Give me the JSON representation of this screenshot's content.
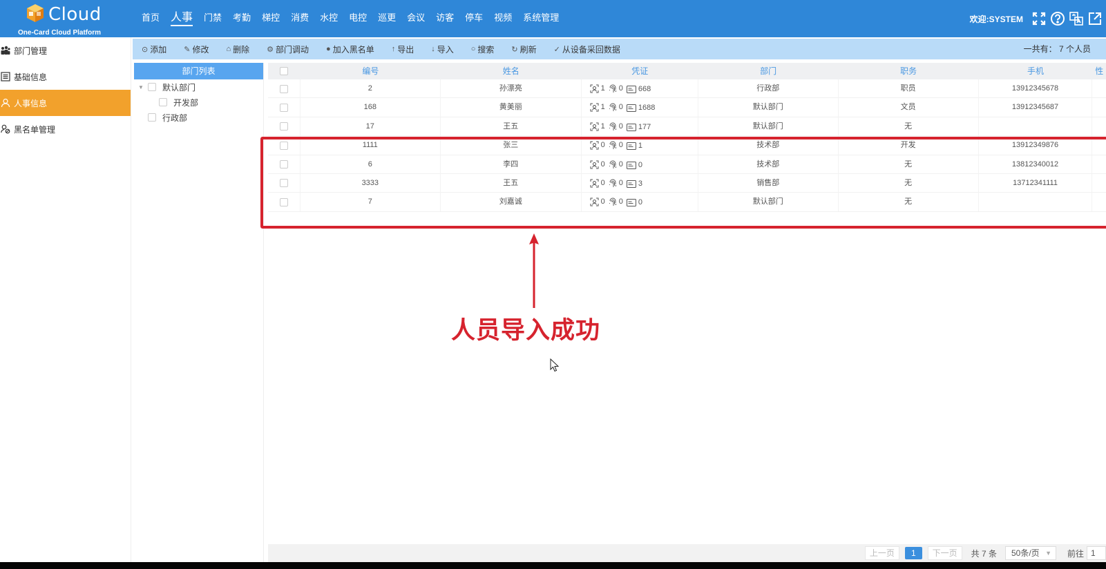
{
  "header": {
    "brand": "Cloud",
    "tagline": "One-Card Cloud Platform",
    "nav": [
      "首页",
      "人事",
      "门禁",
      "考勤",
      "梯控",
      "消费",
      "水控",
      "电控",
      "巡更",
      "会议",
      "访客",
      "停车",
      "视频",
      "系统管理"
    ],
    "active_nav": 1,
    "welcome": "欢迎:SYSTEM",
    "icons": [
      "fullscreen-icon",
      "help-icon",
      "language-icon",
      "logout-icon"
    ]
  },
  "sidebar": {
    "items": [
      {
        "label": "部门管理",
        "icon": "org-chart-icon"
      },
      {
        "label": "基础信息",
        "icon": "list-icon"
      },
      {
        "label": "人事信息",
        "icon": "user-icon"
      },
      {
        "label": "黑名单管理",
        "icon": "blacklist-icon"
      }
    ],
    "active": 2,
    "active_color": "#f2a12c"
  },
  "toolbar": {
    "buttons": [
      {
        "label": "添加",
        "icon": "plus-circle-icon"
      },
      {
        "label": "修改",
        "icon": "edit-icon"
      },
      {
        "label": "删除",
        "icon": "trash-icon"
      },
      {
        "label": "部门调动",
        "icon": "transfer-icon"
      },
      {
        "label": "加入黑名单",
        "icon": "blacklist-add-icon"
      },
      {
        "label": "导出",
        "icon": "export-icon"
      },
      {
        "label": "导入",
        "icon": "import-icon"
      },
      {
        "label": "搜索",
        "icon": "search-icon"
      },
      {
        "label": "刷新",
        "icon": "refresh-icon"
      },
      {
        "label": "从设备采回数据",
        "icon": "check-icon"
      }
    ],
    "total_label": "一共有：",
    "total_value": "7 个人员"
  },
  "tree": {
    "header": "部门列表",
    "nodes": [
      {
        "label": "默认部门",
        "level": 0,
        "expanded": true
      },
      {
        "label": "开发部",
        "level": 1
      },
      {
        "label": "行政部",
        "level": 0
      }
    ]
  },
  "table": {
    "columns": [
      "编号",
      "姓名",
      "凭证",
      "部门",
      "职务",
      "手机",
      "性"
    ],
    "rows": [
      {
        "id": "2",
        "name": "孙漂亮",
        "face": "1",
        "finger": "0",
        "card": "668",
        "dept": "行政部",
        "job": "职员",
        "phone": "13912345678"
      },
      {
        "id": "168",
        "name": "黄美丽",
        "face": "1",
        "finger": "0",
        "card": "1688",
        "dept": "默认部门",
        "job": "文员",
        "phone": "13912345687"
      },
      {
        "id": "17",
        "name": "王五",
        "face": "1",
        "finger": "0",
        "card": "177",
        "dept": "默认部门",
        "job": "无",
        "phone": ""
      },
      {
        "id": "1111",
        "name": "张三",
        "face": "0",
        "finger": "0",
        "card": "1",
        "dept": "技术部",
        "job": "开发",
        "phone": "13912349876"
      },
      {
        "id": "6",
        "name": "李四",
        "face": "0",
        "finger": "0",
        "card": "0",
        "dept": "技术部",
        "job": "无",
        "phone": "13812340012"
      },
      {
        "id": "3333",
        "name": "王五",
        "face": "0",
        "finger": "0",
        "card": "3",
        "dept": "销售部",
        "job": "无",
        "phone": "13712341111"
      },
      {
        "id": "7",
        "name": "刘嘉诚",
        "face": "0",
        "finger": "0",
        "card": "0",
        "dept": "默认部门",
        "job": "无",
        "phone": ""
      }
    ]
  },
  "pager": {
    "prev": "上一页",
    "current": "1",
    "next": "下一页",
    "total": "共 7 条",
    "page_size": "50条/页",
    "goto_label": "前往",
    "goto_value": "1"
  },
  "annotation": {
    "text": "人员导入成功",
    "color": "#d6232e"
  }
}
